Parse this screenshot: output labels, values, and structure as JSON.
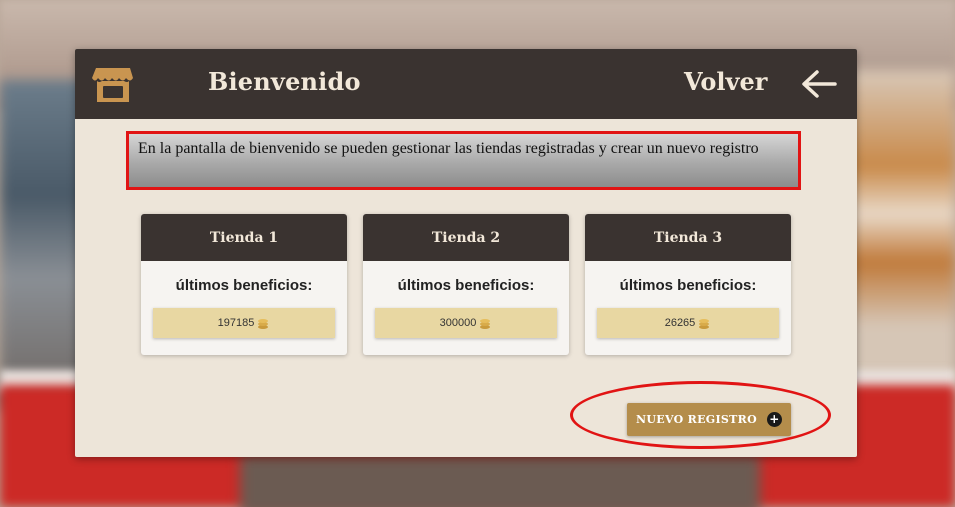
{
  "header": {
    "title": "Bienvenido",
    "back_label": "Volver"
  },
  "info": {
    "text": "En la pantalla de bienvenido se pueden gestionar las tiendas registradas y crear un nuevo registro"
  },
  "stores": [
    {
      "name": "Tienda 1",
      "subtitle": "últimos beneficios:",
      "value": "197185"
    },
    {
      "name": "Tienda 2",
      "subtitle": "últimos beneficios:",
      "value": "300000"
    },
    {
      "name": "Tienda 3",
      "subtitle": "últimos beneficios:",
      "value": "26265"
    }
  ],
  "actions": {
    "new_register_label": "NUEVO REGISTRO"
  },
  "icons": {
    "shop": "shop-icon",
    "back": "arrow-left-icon",
    "coin": "coins-icon",
    "plus": "plus-circle-icon"
  },
  "colors": {
    "header_bg": "#3a3330",
    "panel_bg": "#ede5d9",
    "accent": "#b48d4b",
    "value_bg": "#e8d7a2",
    "highlight": "#e11414"
  }
}
